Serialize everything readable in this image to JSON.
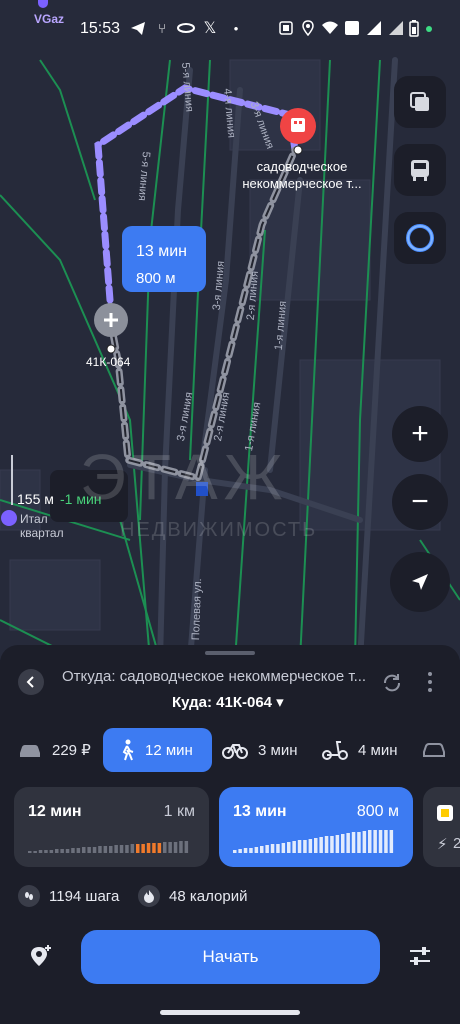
{
  "status_bar": {
    "app_label": "VGaz",
    "time": "15:53",
    "icons": [
      "telegram-icon",
      "fork-icon",
      "ring-icon",
      "x-icon",
      "photo-icon",
      "location-icon",
      "wifi-icon",
      "sim-lte-icon",
      "signal-icon",
      "battery-icon",
      "dot-icon"
    ]
  },
  "map": {
    "streets": [
      "5-я линия",
      "4-я линия",
      "3-я линия",
      "5-я линия",
      "3-я линия",
      "2-я линия",
      "1-я линия",
      "3-я линия",
      "2-я линия",
      "1-я линия",
      "Полевая ул."
    ],
    "destination_label_line1": "садоводческое",
    "destination_label_line2": "некоммерческое т...",
    "origin_label": "41К-064",
    "route_time": "13 мин",
    "route_distance": "800 м",
    "eta_distance": "155 м",
    "eta_delta": "-1 мин",
    "poi_label_line1": "Итал",
    "poi_label_line2": "квартал",
    "watermark_line1": "ЭТАЖ",
    "watermark_line2": "НЕДВИЖИМОСТЬ",
    "buttons": {
      "layers": "layers-icon",
      "transit": "bus-icon",
      "assistant": "alice-icon",
      "zoom_in": "+",
      "zoom_out": "−",
      "locate": "navigation-arrow-icon"
    }
  },
  "sheet": {
    "from_text": "Откуда: садоводческое некоммерческое т...",
    "to_text": "Куда: 41К-064 ▾",
    "modes": [
      {
        "icon": "car-icon",
        "label": "229 ₽"
      },
      {
        "icon": "walk-icon",
        "label": "12 мин",
        "active": true
      },
      {
        "icon": "bike-icon",
        "label": "3 мин"
      },
      {
        "icon": "scooter-icon",
        "label": "4 мин"
      },
      {
        "icon": "taxi-icon",
        "label": ""
      }
    ],
    "cards": [
      {
        "time": "12 мин",
        "distance": "1 км"
      },
      {
        "time": "13 мин",
        "distance": "800 м"
      },
      {
        "time": "",
        "distance": "2"
      }
    ],
    "steps": "1194 шага",
    "calories": "48 калорий",
    "start_label": "Начать",
    "colors": {
      "accent": "#3d7bf2",
      "route": "#9b8dff",
      "orange": "#f07a2b"
    }
  }
}
